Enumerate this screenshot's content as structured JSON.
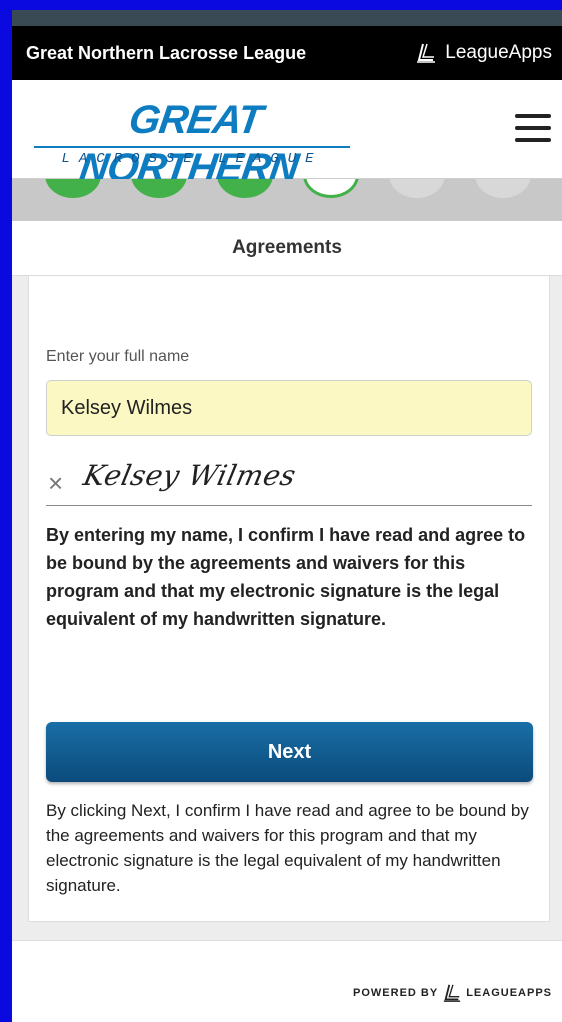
{
  "brand_bar": {
    "league_name": "Great Northern Lacrosse League",
    "leagueapps_label": "LeagueApps"
  },
  "header": {
    "logo_main": "GREAT NORTHERN",
    "logo_sub": "LACROSSE LEAGUE",
    "menu_icon": "hamburger-menu-icon"
  },
  "progress": {
    "steps": [
      "done",
      "done",
      "done",
      "current",
      "todo",
      "todo"
    ]
  },
  "section_title": "Agreements",
  "form": {
    "name_label": "Enter your full name",
    "name_value": "Kelsey Wilmes",
    "signature_prefix": "×",
    "signature_text": "Kelsey Wilmes",
    "consent_bold": "By entering my name, I confirm I have read and agree to be bound by the agreements and waivers for this program and that my electronic signature is the legal equivalent of my handwritten signature.",
    "next_label": "Next",
    "consent_plain": "By clicking Next, I confirm I have read and agree to be bound by the agreements and waivers for this program and that my electronic signature is the legal equivalent of my handwritten signature."
  },
  "footer": {
    "powered_by": "POWERED BY",
    "powered_brand": "LEAGUEAPPS"
  },
  "colors": {
    "accent_blue": "#0e7cc0",
    "button_blue": "#0b4b7c",
    "step_green": "#43b149",
    "input_yellow": "#fbf8c3"
  }
}
